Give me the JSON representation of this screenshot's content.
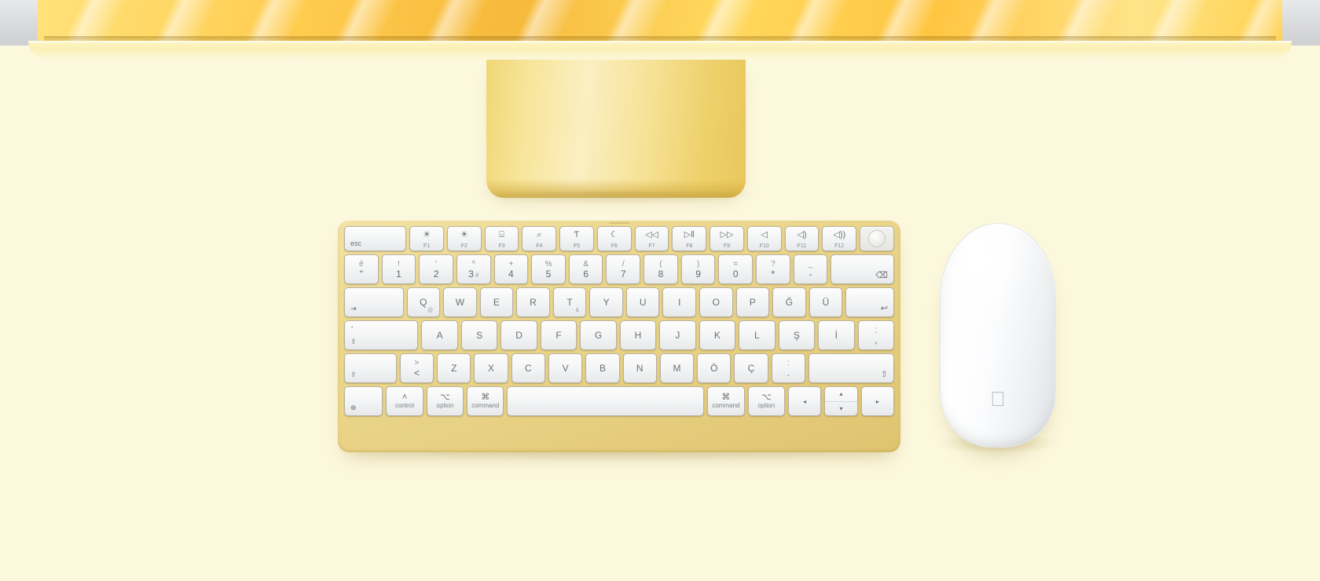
{
  "scene": {
    "product": "iMac with Magic Keyboard and Magic Mouse",
    "colors": {
      "background": "#fcf8de",
      "imac_yellow": "#ffd14f",
      "keyboard_frame": "#e8d184",
      "key_face": "#f4f5f6",
      "key_text": "#6c6f72",
      "mouse_white": "#ffffff"
    }
  },
  "keyboard": {
    "layout_name": "Turkish Q",
    "function_row": [
      {
        "icon": "escape",
        "main": "esc",
        "sub": ""
      },
      {
        "icon": "brightness-down-icon",
        "glyph": "☀",
        "sub": "F1"
      },
      {
        "icon": "brightness-up-icon",
        "glyph": "☀",
        "sub": "F2"
      },
      {
        "icon": "mission-control-icon",
        "glyph": "⌸",
        "sub": "F3"
      },
      {
        "icon": "spotlight-search-icon",
        "glyph": "⌕",
        "sub": "F4"
      },
      {
        "icon": "dictation-mic-icon",
        "glyph": "Ƭ",
        "sub": "F5"
      },
      {
        "icon": "do-not-disturb-moon-icon",
        "glyph": "☾",
        "sub": "F6"
      },
      {
        "icon": "rewind-icon",
        "glyph": "◁◁",
        "sub": "F7"
      },
      {
        "icon": "play-pause-icon",
        "glyph": "▷‖",
        "sub": "F8"
      },
      {
        "icon": "fast-forward-icon",
        "glyph": "▷▷",
        "sub": "F9"
      },
      {
        "icon": "mute-icon",
        "glyph": "◁",
        "sub": "F10"
      },
      {
        "icon": "volume-down-icon",
        "glyph": "◁)",
        "sub": "F11"
      },
      {
        "icon": "volume-up-icon",
        "glyph": "◁))",
        "sub": "F12"
      },
      {
        "icon": "touch-id-icon",
        "glyph": "",
        "sub": ""
      }
    ],
    "number_row": [
      {
        "up": "é",
        "lo": "\"",
        "extra": ""
      },
      {
        "up": "!",
        "lo": "1",
        "extra": ""
      },
      {
        "up": "'",
        "lo": "2",
        "extra": ""
      },
      {
        "up": "^",
        "lo": "3",
        "extra": "#"
      },
      {
        "up": "+",
        "lo": "4",
        "extra": ""
      },
      {
        "up": "%",
        "lo": "5",
        "extra": ""
      },
      {
        "up": "&",
        "lo": "6",
        "extra": ""
      },
      {
        "up": "/",
        "lo": "7",
        "extra": ""
      },
      {
        "up": "(",
        "lo": "8",
        "extra": ""
      },
      {
        "up": ")",
        "lo": "9",
        "extra": ""
      },
      {
        "up": "=",
        "lo": "0",
        "extra": ""
      },
      {
        "up": "?",
        "lo": "*",
        "extra": ""
      },
      {
        "up": "_",
        "lo": "-",
        "extra": ""
      },
      {
        "up": "",
        "lo": "⌫",
        "extra": ""
      }
    ],
    "top_letter_row": [
      {
        "main": "⇥",
        "sub": ""
      },
      {
        "main": "Q",
        "sub": "@"
      },
      {
        "main": "W",
        "sub": ""
      },
      {
        "main": "E",
        "sub": ""
      },
      {
        "main": "R",
        "sub": ""
      },
      {
        "main": "T",
        "sub": "₺"
      },
      {
        "main": "Y",
        "sub": ""
      },
      {
        "main": "U",
        "sub": ""
      },
      {
        "main": "I",
        "sub": ""
      },
      {
        "main": "O",
        "sub": ""
      },
      {
        "main": "P",
        "sub": ""
      },
      {
        "main": "Ğ",
        "sub": ""
      },
      {
        "main": "Ü",
        "sub": ""
      },
      {
        "main": "↩",
        "sub": ""
      }
    ],
    "home_row": [
      {
        "main": "⇪",
        "dot": "•"
      },
      {
        "main": "A"
      },
      {
        "main": "S"
      },
      {
        "main": "D"
      },
      {
        "main": "F"
      },
      {
        "main": "G"
      },
      {
        "main": "H"
      },
      {
        "main": "J"
      },
      {
        "main": "K"
      },
      {
        "main": "L"
      },
      {
        "main": "Ş"
      },
      {
        "main": "İ"
      },
      {
        "up": ";",
        "lo": ","
      }
    ],
    "bottom_letter_row": [
      {
        "main": "⇧"
      },
      {
        "up": ">",
        "lo": "<"
      },
      {
        "main": "Z"
      },
      {
        "main": "X"
      },
      {
        "main": "C"
      },
      {
        "main": "V"
      },
      {
        "main": "B"
      },
      {
        "main": "N"
      },
      {
        "main": "M"
      },
      {
        "main": "Ö"
      },
      {
        "main": "Ç"
      },
      {
        "up": ":",
        "lo": "."
      },
      {
        "main": "⇧"
      }
    ],
    "modifier_row": [
      {
        "sym": "⊕",
        "name": "",
        "icon": "globe-icon"
      },
      {
        "sym": "˄",
        "name": "control",
        "icon": "control-icon"
      },
      {
        "sym": "⌥",
        "name": "option",
        "icon": "option-icon"
      },
      {
        "sym": "⌘",
        "name": "command",
        "icon": "command-icon"
      },
      {
        "sym": "",
        "name": "",
        "icon": "space-bar"
      },
      {
        "sym": "⌘",
        "name": "command",
        "icon": "command-icon"
      },
      {
        "sym": "⌥",
        "name": "option",
        "icon": "option-icon"
      },
      {
        "sym": "◂",
        "name": "",
        "icon": "arrow-left-icon"
      },
      {
        "sym": "▴",
        "name": "▾",
        "icon": "arrow-up-down-icon"
      },
      {
        "sym": "▸",
        "name": "",
        "icon": "arrow-right-icon"
      }
    ]
  },
  "mouse": {
    "name": "Magic Mouse",
    "logo": ""
  }
}
